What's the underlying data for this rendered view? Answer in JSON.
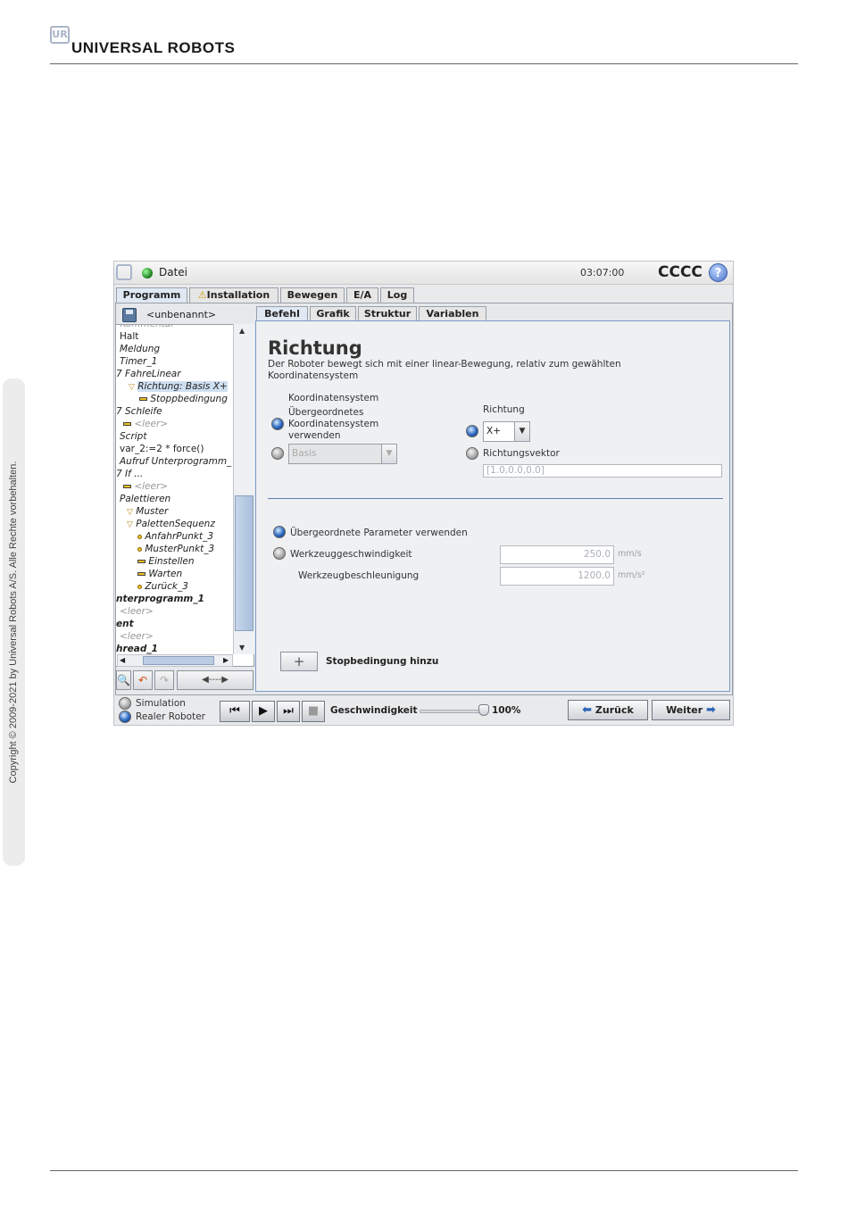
{
  "page": {
    "logo_text": "UR",
    "brand": "UNIVERSAL ROBOTS",
    "copyright": "Copyright © 2009-2021 by Universal Robots A/S. Alle Rechte vorbehalten."
  },
  "app": {
    "file_menu": "Datei",
    "time": "03:07:00",
    "robot_name": "CCCC",
    "help_icon": "?",
    "main_tabs": [
      "Programm",
      "Installation",
      "Bewegen",
      "E/A",
      "Log"
    ],
    "program_name": "<unbenannt>",
    "sub_tabs": [
      "Befehl",
      "Grafik",
      "Struktur",
      "Variablen"
    ]
  },
  "tree": [
    {
      "text": "Kommentar",
      "style": "muted"
    },
    {
      "text": "Halt",
      "style": ""
    },
    {
      "text": "Meldung",
      "style": "it"
    },
    {
      "text": "Timer_1",
      "style": "it"
    },
    {
      "text": "7 FahreLinear",
      "style": "it"
    },
    {
      "text": "Richtung: Basis X+",
      "style": "it",
      "marker": "tri",
      "selected": true
    },
    {
      "text": "Stoppbedingung",
      "style": "it",
      "marker": "dash"
    },
    {
      "text": "7 Schleife",
      "style": "it"
    },
    {
      "text": "<leer>",
      "style": "it muted",
      "marker": "dash"
    },
    {
      "text": "Script",
      "style": "it"
    },
    {
      "text": "var_2:=2 * force()",
      "style": ""
    },
    {
      "text": "Aufruf Unterprogramm_",
      "style": "it"
    },
    {
      "text": "7 If ...",
      "style": "it"
    },
    {
      "text": "<leer>",
      "style": "it muted",
      "marker": "dash"
    },
    {
      "text": "Palettieren",
      "style": "it"
    },
    {
      "text": "Muster",
      "style": "it",
      "marker": "tri"
    },
    {
      "text": "PalettenSequenz",
      "style": "it",
      "marker": "tri"
    },
    {
      "text": "AnfahrPunkt_3",
      "style": "it",
      "marker": "dot"
    },
    {
      "text": "MusterPunkt_3",
      "style": "it",
      "marker": "dot"
    },
    {
      "text": "Einstellen",
      "style": "it",
      "marker": "dash"
    },
    {
      "text": "Warten",
      "style": "it",
      "marker": "dash"
    },
    {
      "text": "Zurück_3",
      "style": "it",
      "marker": "dot"
    },
    {
      "text": "nterprogramm_1",
      "style": "it bo"
    },
    {
      "text": "<leer>",
      "style": "it muted"
    },
    {
      "text": "ent",
      "style": "it bo"
    },
    {
      "text": "<leer>",
      "style": "it muted"
    },
    {
      "text": "hread_1",
      "style": "it bo"
    }
  ],
  "tree_tools": {
    "search_icon": "🔍",
    "undo_icon": "↶",
    "redo_icon": "↷",
    "move_icon": "◀----▶"
  },
  "content": {
    "title": "Richtung",
    "description": "Der Roboter bewegt sich mit einer linear-Bewegung, relativ zum gewählten Koordinatensystem",
    "coord_label": "Koordinatensystem",
    "coord_parent_option": "Übergeordnetes Koordinatensystem verwenden",
    "coord_select_value": "Basis",
    "direction_label": "Richtung",
    "direction_value": "X+",
    "direction_vector_option": "Richtungsvektor",
    "direction_vector_value": "[1.0,0.0,0.0]",
    "use_parent_params": "Übergeordnete Parameter verwenden",
    "tool_speed_label": "Werkzeuggeschwindigkeit",
    "tool_speed_value": "250.0",
    "tool_speed_unit": "mm/s",
    "tool_accel_label": "Werkzeugbeschleunigung",
    "tool_accel_value": "1200.0",
    "tool_accel_unit": "mm/s²",
    "add_stop_icon": "+",
    "add_stop_label": "Stopbedingung hinzu"
  },
  "bottom": {
    "simulation": "Simulation",
    "real_robot": "Realer Roboter",
    "speed_label": "Geschwindigkeit",
    "speed_value": "100%",
    "speed_fraction": 1.0,
    "back": "Zurück",
    "next": "Weiter"
  },
  "colors": {
    "accent": "#2d64b8",
    "frame_border": "#7b9bc6"
  }
}
